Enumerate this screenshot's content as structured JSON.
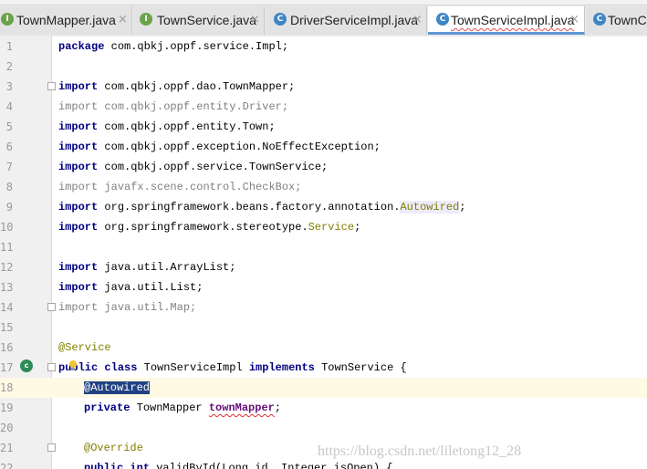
{
  "tabs": [
    {
      "label": "TownMapper.java",
      "icon": "I",
      "close": "×"
    },
    {
      "label": "TownService.java",
      "icon": "I",
      "close": "×"
    },
    {
      "label": "DriverServiceImpl.java",
      "icon": "C",
      "close": "×"
    },
    {
      "label": "TownServiceImpl.java",
      "icon": "C",
      "close": "×"
    },
    {
      "label": "TownCo",
      "icon": "C",
      "close": ""
    }
  ],
  "lines": [
    {
      "n": "1",
      "parts": [
        "package",
        " com.qbkj.oppf.service.Impl;"
      ]
    },
    {
      "n": "2"
    },
    {
      "n": "3",
      "parts": [
        "import",
        " com.qbkj.oppf.dao.TownMapper;"
      ]
    },
    {
      "n": "4",
      "parts": [
        "import",
        " com.qbkj.oppf.entity.Driver;"
      ]
    },
    {
      "n": "5",
      "parts": [
        "import",
        " com.qbkj.oppf.entity.Town;"
      ]
    },
    {
      "n": "6",
      "parts": [
        "import",
        " com.qbkj.oppf.exception.NoEffectException;"
      ]
    },
    {
      "n": "7",
      "parts": [
        "import",
        " com.qbkj.oppf.service.TownService;"
      ]
    },
    {
      "n": "8",
      "parts": [
        "import",
        " javafx.scene.control.CheckBox;"
      ]
    },
    {
      "n": "9",
      "parts": [
        "import",
        " org.springframework.beans.factory.annotation.",
        "Autowired",
        ";"
      ]
    },
    {
      "n": "10",
      "parts": [
        "import",
        " org.springframework.stereotype.",
        "Service",
        ";"
      ]
    },
    {
      "n": "11"
    },
    {
      "n": "12",
      "parts": [
        "import",
        " java.util.ArrayList;"
      ]
    },
    {
      "n": "13",
      "parts": [
        "import",
        " java.util.List;"
      ]
    },
    {
      "n": "14",
      "parts": [
        "import",
        " java.util.Map;"
      ]
    },
    {
      "n": "15"
    },
    {
      "n": "16",
      "parts": [
        "@Service"
      ]
    },
    {
      "n": "17",
      "parts": [
        "public",
        " ",
        "class",
        " TownServiceImpl ",
        "implements",
        " TownService {"
      ]
    },
    {
      "n": "18",
      "parts": [
        "@Autowired"
      ]
    },
    {
      "n": "19",
      "parts": [
        "private",
        " TownMapper ",
        "townMapper",
        ";"
      ]
    },
    {
      "n": "20"
    },
    {
      "n": "21",
      "parts": [
        "@Override"
      ]
    },
    {
      "n": "22",
      "parts": [
        "public",
        " ",
        "int",
        " validById(Long id, Integer isOpen) {"
      ]
    }
  ],
  "watermark": "https://blog.csdn.net/liletong12_28",
  "colors": {
    "keyword": "#000080",
    "annotation": "#808000",
    "unused": "#808080",
    "selection": "#214283",
    "current_line": "#fffae3"
  }
}
